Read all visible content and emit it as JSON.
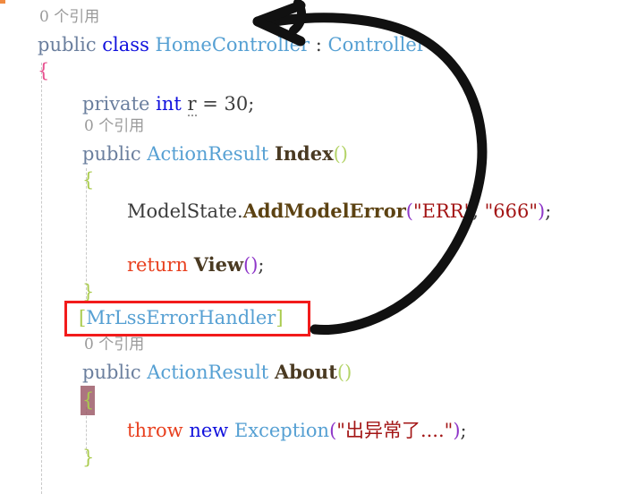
{
  "editor": {
    "language": "csharp",
    "background": "#ffffff",
    "codelens_color": "#9a9a9a",
    "lines": [
      {
        "id": "l1",
        "kind": "codelens",
        "text": "0 个引用"
      },
      {
        "id": "l2",
        "kind": "code",
        "text": "public class HomeController : Controller"
      },
      {
        "id": "l3",
        "kind": "code",
        "text": "{"
      },
      {
        "id": "l4",
        "kind": "code",
        "text": "    private int r = 30;"
      },
      {
        "id": "l5",
        "kind": "codelens",
        "text": "0 个引用"
      },
      {
        "id": "l6",
        "kind": "code",
        "text": "    public ActionResult Index()"
      },
      {
        "id": "l7",
        "kind": "code",
        "text": "    {"
      },
      {
        "id": "l8",
        "kind": "code",
        "text": "        ModelState.AddModelError(\"ERR\", \"666\");"
      },
      {
        "id": "l9",
        "kind": "code",
        "text": ""
      },
      {
        "id": "l10",
        "kind": "code",
        "text": "        return View();"
      },
      {
        "id": "l11",
        "kind": "code",
        "text": "    }"
      },
      {
        "id": "l12",
        "kind": "code",
        "text": "    [MrLssErrorHandler]"
      },
      {
        "id": "l13",
        "kind": "codelens",
        "text": "0 个引用"
      },
      {
        "id": "l14",
        "kind": "code",
        "text": "    public ActionResult About()"
      },
      {
        "id": "l15",
        "kind": "code",
        "text": "    {"
      },
      {
        "id": "l16",
        "kind": "code",
        "text": ""
      },
      {
        "id": "l17",
        "kind": "code",
        "text": "        throw new Exception(\"出异常了....\");"
      },
      {
        "id": "l18",
        "kind": "code",
        "text": "    }"
      }
    ],
    "tokens": {
      "codelens_1": "0 个引用",
      "kw_public_1": "public",
      "kw_class": "class",
      "type_homecontroller": "HomeController",
      "colon": " : ",
      "type_controller": "Controller",
      "brace_class_open": "{",
      "kw_private": "private",
      "kw_int": "int",
      "var_r": "r",
      "assign_30": "= 30;",
      "codelens_2": "0 个引用",
      "kw_public_2": "public",
      "type_actionresult_1": "ActionResult",
      "method_index": "Index",
      "parens_index": "()",
      "brace_index_open": "{",
      "obj_modelstate": "ModelState.",
      "method_addmodelerror": "AddModelError",
      "paren_open_1": "(",
      "str_err": "\"ERR\"",
      "comma_1": ", ",
      "str_666": "\"666\"",
      "paren_close_1": ")",
      "semi_1": ";",
      "kw_return": "return",
      "method_view": "View",
      "parens_view": "()",
      "semi_2": ";",
      "brace_index_close": "}",
      "attr_open_bracket": "[",
      "attr_name": "MrLssErrorHandler",
      "attr_close_bracket": "]",
      "codelens_3": "0 个引用",
      "kw_public_3": "public",
      "type_actionresult_2": "ActionResult",
      "method_about": "About",
      "parens_about": "()",
      "brace_about_open": "{",
      "kw_throw": "throw",
      "kw_new": "new",
      "type_exception": "Exception",
      "paren_open_2": "(",
      "str_chinese_exception": "\"出异常了....\"",
      "paren_close_2": ")",
      "semi_3": ";",
      "brace_about_close": "}"
    },
    "colors": {
      "keyword_muted": "#6b7f9e",
      "keyword_blue": "#1111dd",
      "keyword_red": "#e8401f",
      "type": "#56a0d3",
      "identifier": "#4a3a22",
      "string": "#a31515",
      "paren_purple": "#8f37c9",
      "paren_green": "#b5d46a",
      "brace_pink": "#e8508f",
      "brace_green": "#aacb4e",
      "plain": "#3b3b3b",
      "indent_guide": "#c9c9c9",
      "selection_block": "#9d5d6a"
    }
  },
  "annotations": {
    "highlight_box": {
      "name": "red-rectangle-around-attribute",
      "color": "#f21b1b",
      "target_text": "[MrLssErrorHandler]"
    },
    "arrow": {
      "name": "hand-drawn-curved-arrow",
      "color": "#111111",
      "points_from": "[MrLssErrorHandler]",
      "points_to": "class HomeController declaration"
    },
    "corner_mark": {
      "name": "orange-corner-mark",
      "color": "#f08a40"
    }
  }
}
